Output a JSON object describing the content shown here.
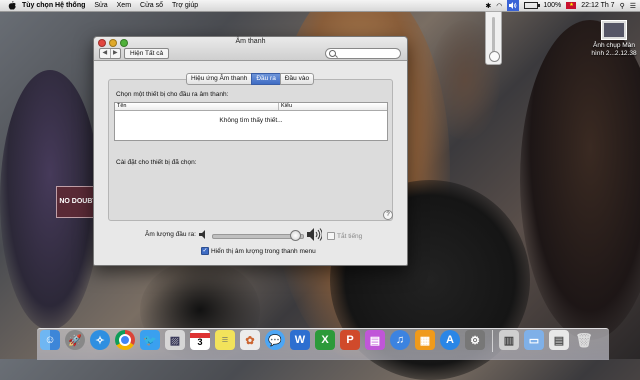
{
  "menubar": {
    "app_name": "Tùy chọn Hệ thống",
    "menus": [
      "Sửa",
      "Xem",
      "Cửa sổ",
      "Trợ giúp"
    ],
    "battery": "100%",
    "clock": "22:12 Th 7"
  },
  "desktop": {
    "sign_text": "NO DOUBT",
    "icon_label": "Ảnh chụp Màn hình 2...2.12.38"
  },
  "window": {
    "title": "Âm thanh",
    "show_all": "Hiện Tất cả",
    "search_placeholder": "",
    "tabs": [
      {
        "label": "Hiệu ứng Âm thanh",
        "active": false
      },
      {
        "label": "Đầu ra",
        "active": true
      },
      {
        "label": "Đầu vào",
        "active": false
      }
    ],
    "select_heading": "Chọn một thiết bị cho đầu ra âm thanh:",
    "columns": [
      "Tên",
      "Kiểu"
    ],
    "empty_message": "Không tìm thấy thiết...",
    "settings_label": "Cài đặt cho thiết bị đã chọn:",
    "help": "?",
    "output_volume_label": "Âm lượng đầu ra:",
    "output_volume_level": 0.92,
    "mute_label": "Tắt tiếng",
    "show_volume_label": "Hiển thị âm lượng trong thanh menu",
    "show_volume_checked": true
  },
  "dock": {
    "items": [
      "finder-icon",
      "launchpad-icon",
      "safari-icon",
      "chrome-icon",
      "twitter-icon",
      "preview-icon",
      "calendar-icon",
      "stickies-icon",
      "photos-icon",
      "messages-icon",
      "word-icon",
      "excel-icon",
      "powerpoint-icon",
      "system-monitor-icon",
      "itunes-icon",
      "books-icon",
      "app-store-icon",
      "system-preferences-icon",
      "downloads-stack-icon",
      "folder-icon",
      "documents-stack-icon",
      "trash-icon"
    ],
    "calendar_day": "3"
  }
}
